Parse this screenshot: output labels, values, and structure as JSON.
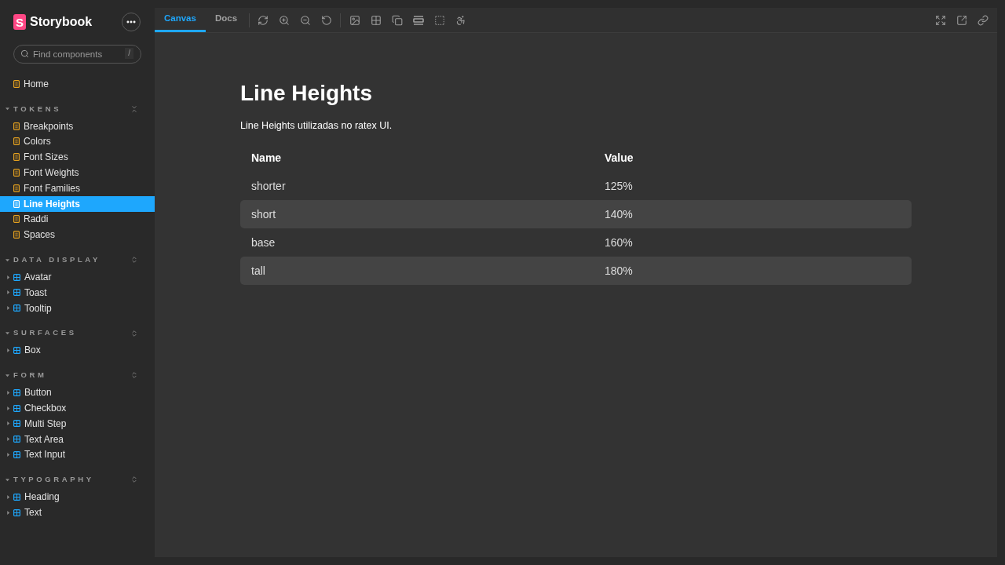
{
  "sidebar": {
    "brand": {
      "logo_letter": "S",
      "name": "Storybook"
    },
    "search": {
      "placeholder": "Find components",
      "shortcut": "/"
    },
    "items": [
      {
        "label": "Home",
        "kind": "doc",
        "selected": false
      }
    ],
    "sections": [
      {
        "title": "TOKENS",
        "expanded": true,
        "all_expanded": true,
        "items": [
          {
            "label": "Breakpoints",
            "kind": "doc",
            "selected": false
          },
          {
            "label": "Colors",
            "kind": "doc",
            "selected": false
          },
          {
            "label": "Font Sizes",
            "kind": "doc",
            "selected": false
          },
          {
            "label": "Font Weights",
            "kind": "doc",
            "selected": false
          },
          {
            "label": "Font Families",
            "kind": "doc",
            "selected": false
          },
          {
            "label": "Line Heights",
            "kind": "doc",
            "selected": true
          },
          {
            "label": "Raddi",
            "kind": "doc",
            "selected": false
          },
          {
            "label": "Spaces",
            "kind": "doc",
            "selected": false
          }
        ]
      },
      {
        "title": "DATA DISPLAY",
        "expanded": true,
        "all_expanded": false,
        "items": [
          {
            "label": "Avatar",
            "kind": "component",
            "selected": false,
            "expanded": false
          },
          {
            "label": "Toast",
            "kind": "component",
            "selected": false,
            "expanded": false
          },
          {
            "label": "Tooltip",
            "kind": "component",
            "selected": false,
            "expanded": false
          }
        ]
      },
      {
        "title": "SURFACES",
        "expanded": true,
        "all_expanded": false,
        "items": [
          {
            "label": "Box",
            "kind": "component",
            "selected": false,
            "expanded": false
          }
        ]
      },
      {
        "title": "FORM",
        "expanded": true,
        "all_expanded": false,
        "items": [
          {
            "label": "Button",
            "kind": "component",
            "selected": false,
            "expanded": false
          },
          {
            "label": "Checkbox",
            "kind": "component",
            "selected": false,
            "expanded": false
          },
          {
            "label": "Multi Step",
            "kind": "component",
            "selected": false,
            "expanded": false
          },
          {
            "label": "Text Area",
            "kind": "component",
            "selected": false,
            "expanded": false
          },
          {
            "label": "Text Input",
            "kind": "component",
            "selected": false,
            "expanded": false
          }
        ]
      },
      {
        "title": "TYPOGRAPHY",
        "expanded": true,
        "all_expanded": false,
        "items": [
          {
            "label": "Heading",
            "kind": "component",
            "selected": false,
            "expanded": false
          },
          {
            "label": "Text",
            "kind": "component",
            "selected": false,
            "expanded": false
          }
        ]
      }
    ]
  },
  "toolbar": {
    "tabs": [
      {
        "label": "Canvas",
        "selected": true
      },
      {
        "label": "Docs",
        "selected": false
      }
    ]
  },
  "doc": {
    "title": "Line Heights",
    "description": "Line Heights utilizadas no ratex UI.",
    "table": {
      "columns": [
        "Name",
        "Value"
      ],
      "rows": [
        {
          "cells": [
            "shorter",
            "125%"
          ]
        },
        {
          "cells": [
            "short",
            "140%"
          ]
        },
        {
          "cells": [
            "base",
            "160%"
          ]
        },
        {
          "cells": [
            "tall",
            "180%"
          ]
        }
      ]
    }
  }
}
